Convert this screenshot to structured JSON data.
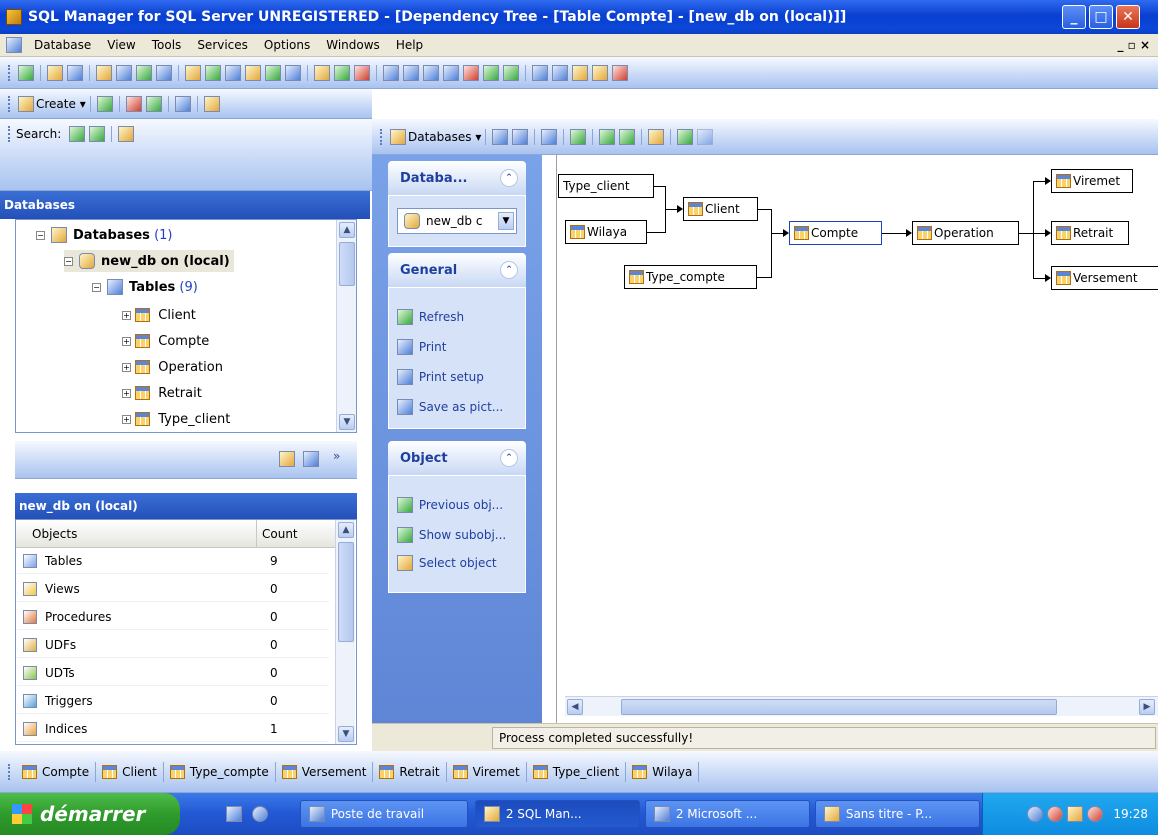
{
  "window": {
    "title": "SQL Manager for SQL Server UNREGISTERED - [Dependency Tree - [Table Compte] - [new_db on (local)]]",
    "min": "_",
    "max": "□",
    "close": "✕"
  },
  "menu": {
    "items": [
      "Database",
      "View",
      "Tools",
      "Services",
      "Options",
      "Windows",
      "Help"
    ],
    "mdi_controls": "_ ▫ ×"
  },
  "left_toolbar": {
    "create_label": "Create ▾"
  },
  "search": {
    "label": "Search:"
  },
  "databases_panel": {
    "title": "Databases",
    "root_label": "Databases",
    "root_count": "(1)",
    "db_label": "new_db on (local)",
    "tables_label": "Tables",
    "tables_count": "(9)",
    "tables": [
      "Client",
      "Compte",
      "Operation",
      "Retrait",
      "Type_client"
    ]
  },
  "objects_panel": {
    "title": "new_db on (local)",
    "col_objects": "Objects",
    "col_count": "Count",
    "rows": [
      {
        "name": "Tables",
        "count": "9"
      },
      {
        "name": "Views",
        "count": "0"
      },
      {
        "name": "Procedures",
        "count": "0"
      },
      {
        "name": "UDFs",
        "count": "0"
      },
      {
        "name": "UDTs",
        "count": "0"
      },
      {
        "name": "Triggers",
        "count": "0"
      },
      {
        "name": "Indices",
        "count": "1"
      }
    ]
  },
  "right_toolbar": {
    "databases_label": "Databases ▾"
  },
  "taskpane": {
    "db_section": "Databa...",
    "db_value": "new_db c",
    "general_section": "General",
    "general_items": [
      "Refresh",
      "Print",
      "Print setup",
      "Save as pict..."
    ],
    "object_section": "Object",
    "object_items": [
      "Previous obj...",
      "Show subobj...",
      "Select object"
    ]
  },
  "diagram": {
    "nodes": {
      "type_client": "Type_client",
      "wilaya": "Wilaya",
      "type_compte": "Type_compte",
      "client": "Client",
      "compte": "Compte",
      "operation": "Operation",
      "viremet": "Viremet",
      "retrait": "Retrait",
      "versement": "Versement"
    }
  },
  "status": {
    "message": "Process completed successfully!"
  },
  "window_tabs": [
    "Compte",
    "Client",
    "Type_compte",
    "Versement",
    "Retrait",
    "Viremet",
    "Type_client",
    "Wilaya"
  ],
  "taskbar": {
    "start": "démarrer",
    "buttons": [
      "Poste de travail",
      "2 SQL Man...",
      "2 Microsoft ...",
      "Sans titre - P..."
    ],
    "clock": "19:28"
  }
}
